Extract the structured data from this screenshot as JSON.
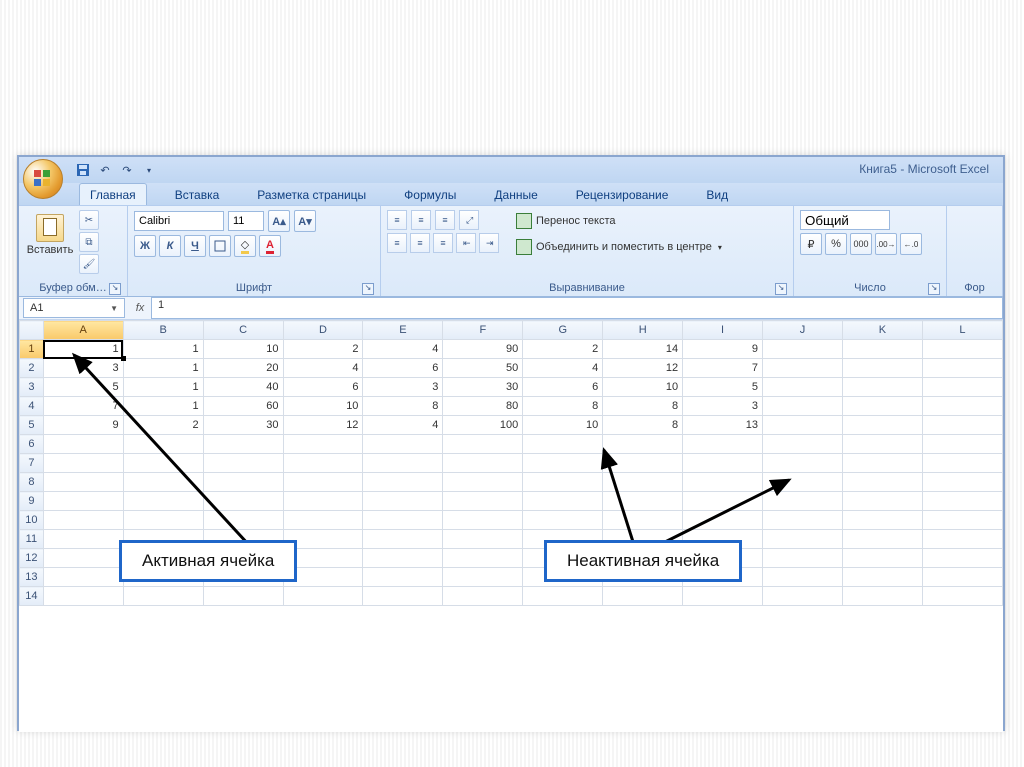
{
  "app_title": "Книга5 - Microsoft Excel",
  "tabs": [
    "Главная",
    "Вставка",
    "Разметка страницы",
    "Формулы",
    "Данные",
    "Рецензирование",
    "Вид"
  ],
  "active_tab": 0,
  "ribbon": {
    "clipboard": {
      "paste": "Вставить",
      "title": "Буфер обм…"
    },
    "font": {
      "name": "Calibri",
      "size": "11",
      "title": "Шрифт",
      "bold": "Ж",
      "italic": "К",
      "underline": "Ч"
    },
    "alignment": {
      "wrap": "Перенос текста",
      "merge": "Объединить и поместить в центре",
      "title": "Выравнивание"
    },
    "number": {
      "format": "Общий",
      "title": "Число"
    },
    "format_label": "Фор"
  },
  "namebox": "A1",
  "formula_value": "1",
  "columns": [
    "A",
    "B",
    "C",
    "D",
    "E",
    "F",
    "G",
    "H",
    "I",
    "J",
    "K",
    "L"
  ],
  "row_headers": [
    "1",
    "2",
    "3",
    "4",
    "5",
    "6",
    "7",
    "8",
    "9",
    "10",
    "11",
    "12",
    "13",
    "14"
  ],
  "active_cell": {
    "row": 0,
    "col": 0
  },
  "chart_data": {
    "type": "table",
    "columns": [
      "A",
      "B",
      "C",
      "D",
      "E",
      "F",
      "G",
      "H",
      "I"
    ],
    "rows": [
      [
        1,
        1,
        10,
        2,
        4,
        90,
        2,
        14,
        9
      ],
      [
        3,
        1,
        20,
        4,
        6,
        50,
        4,
        12,
        7
      ],
      [
        5,
        1,
        40,
        6,
        3,
        30,
        6,
        10,
        5
      ],
      [
        7,
        1,
        60,
        10,
        8,
        80,
        8,
        8,
        3
      ],
      [
        9,
        2,
        30,
        12,
        4,
        100,
        10,
        8,
        13
      ]
    ]
  },
  "annotations": {
    "active": "Активная ячейка",
    "inactive": "Неактивная ячейка"
  }
}
